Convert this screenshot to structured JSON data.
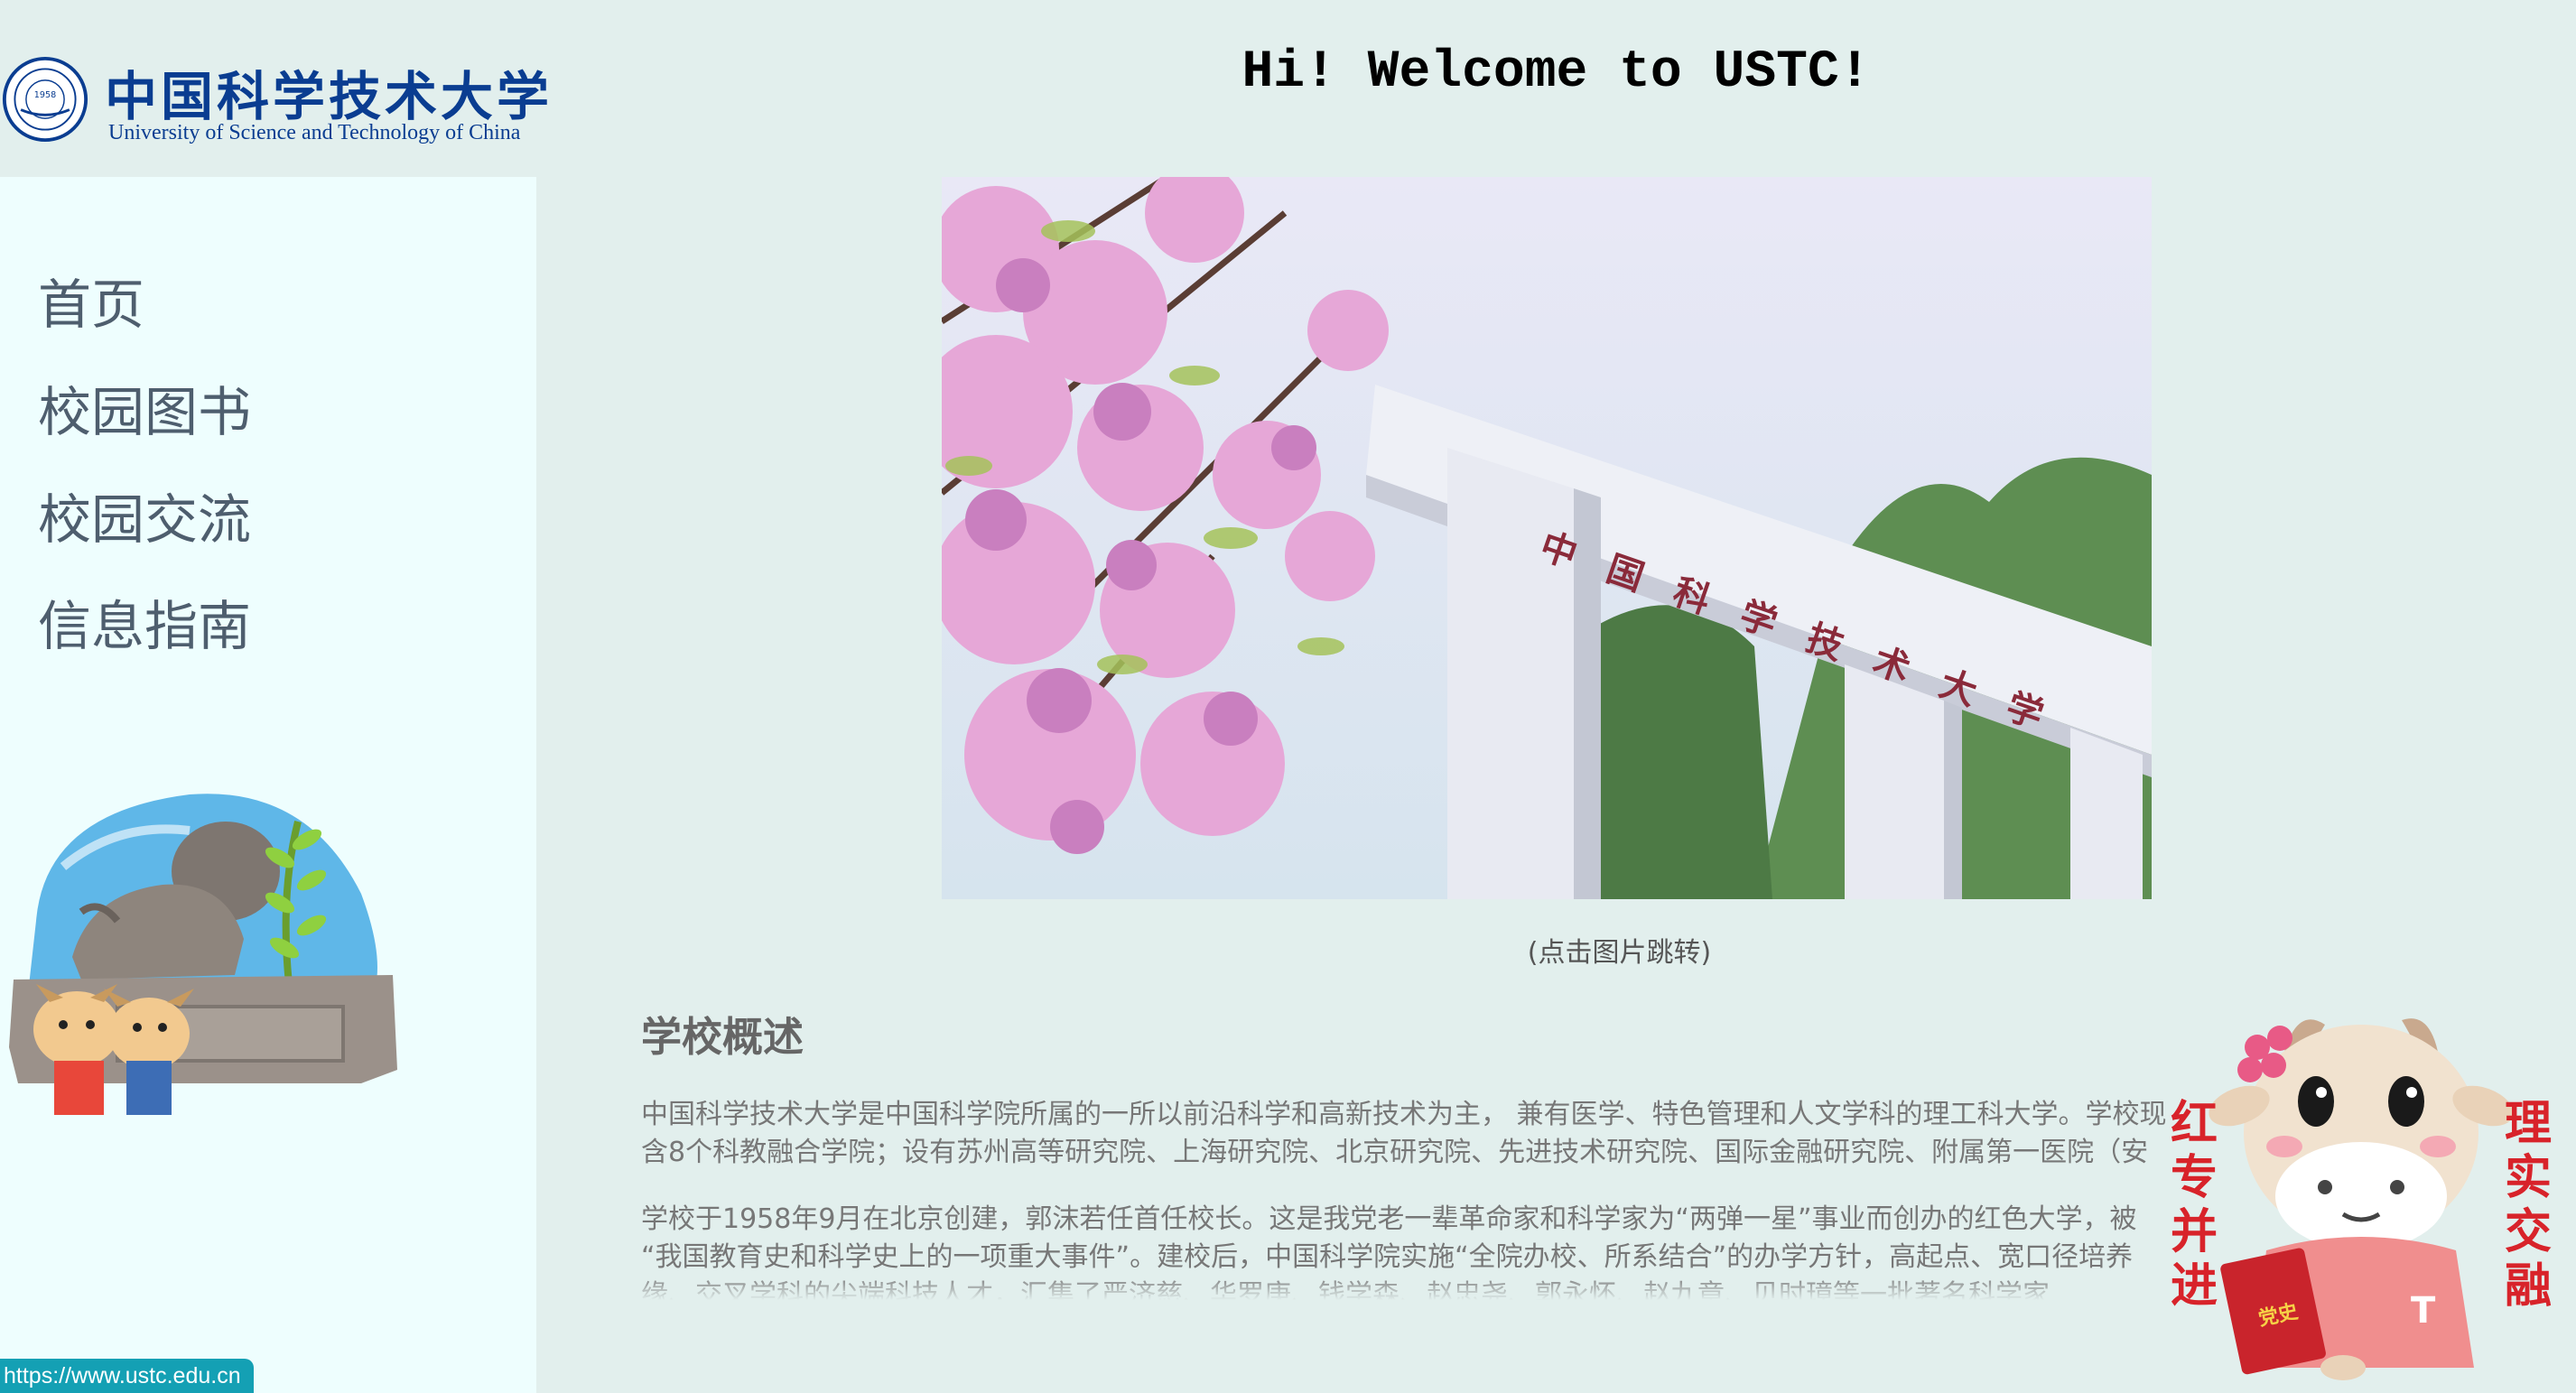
{
  "logo": {
    "title_cn": "中国科学技术大学",
    "title_en": "University of Science and Technology of China",
    "seal_year": "1958"
  },
  "nav": {
    "items": [
      {
        "label": "首页"
      },
      {
        "label": "校园图书"
      },
      {
        "label": "校园交流"
      },
      {
        "label": "信息指南"
      }
    ]
  },
  "main": {
    "welcome": "Hi! Welcome to USTC!",
    "caption": "(点击图片跳转)",
    "overview_title": "学校概述",
    "para1_line1": "中国科学技术大学是中国科学院所属的一所以前沿科学和高新技术为主， 兼有医学、特色管理和人文学科的理工科大学。学校现",
    "para1_line2": "含8个科教融合学院；设有苏州高等研究院、上海研究院、北京研究院、先进技术研究院、国际金融研究院、附属第一医院（安",
    "para2_line1": "学校于1958年9月在北京创建，郭沫若任首任校长。这是我党老一辈革命家和科学家为“两弹一星”事业而创办的红色大学，被",
    "para2_line2": "“我国教育史和科学史上的一项重大事件”。建校后，中国科学院实施“全院办校、所系结合”的办学方针，高起点、宽口径培养",
    "para2_line3": "缘、交叉学科的尖端科技人才，汇集了严济慈、华罗庚、钱学森、赵忠尧、郭永怀、赵九章、贝时璋等一批著名科学家"
  },
  "gate_sign": "中国科学技术大学",
  "mascot_right": {
    "left_slogan": [
      "红",
      "专",
      "并",
      "进"
    ],
    "right_slogan": [
      "理",
      "实",
      "交",
      "融"
    ],
    "book_label": "党史",
    "shirt_text": "T"
  },
  "status_bar": {
    "url": "https://www.ustc.edu.cn"
  },
  "colors": {
    "page_bg": "#e2efed",
    "sidebar_bg": "#eefefe",
    "logo_blue": "#0a3d91",
    "status_bg": "#14a0b4",
    "slogan_red": "#d8232a"
  }
}
